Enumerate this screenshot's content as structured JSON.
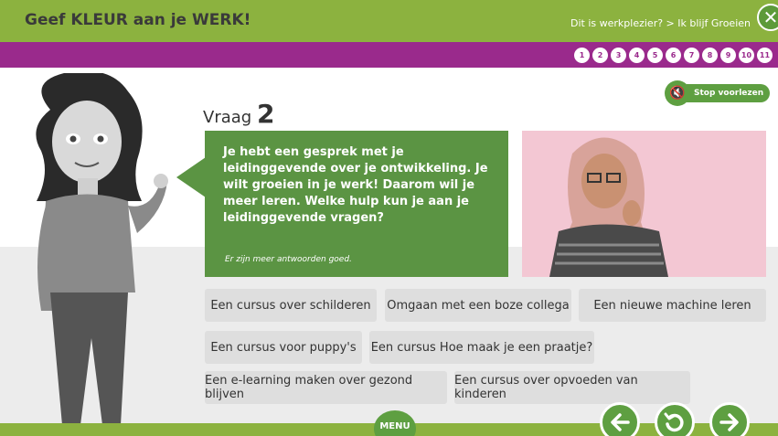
{
  "header": {
    "title": "Geef KLEUR aan je WERK!",
    "breadcrumb": "Dit is werkplezier? > Ik blijf Groeien",
    "close_icon": "close-icon"
  },
  "steps": [
    "1",
    "2",
    "3",
    "4",
    "5",
    "6",
    "7",
    "8",
    "9",
    "10",
    "11"
  ],
  "colors": {
    "green": "#8cb23f",
    "dark_green": "#5b9443",
    "purple": "#9a2a8c"
  },
  "voice": {
    "label": "Stop voorlezen",
    "icon": "speaker-mute-icon"
  },
  "question": {
    "prefix": "Vraag",
    "number": "2",
    "text": "Je hebt een gesprek met je leidinggevende over je ontwikkeling. Je wilt groeien in je werk! Daarom wil je meer leren. Welke hulp kun je aan je leidinggevende vragen?",
    "hint": "Er zijn meer antwoorden goed."
  },
  "answers": [
    "Een cursus over schilderen",
    "Omgaan met een boze collega",
    "Een nieuwe machine leren",
    "Een cursus voor puppy's",
    "Een cursus Hoe maak je een praatje?",
    "Een e-learning maken over gezond blijven",
    "Een cursus over opvoeden van kinderen"
  ],
  "footer": {
    "menu_label": "MENU",
    "back_icon": "arrow-left-icon",
    "replay_icon": "replay-icon",
    "next_icon": "arrow-right-icon"
  }
}
